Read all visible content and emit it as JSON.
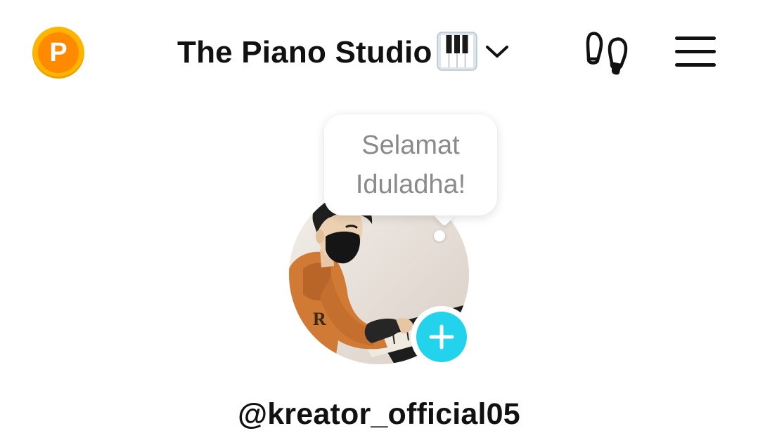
{
  "header": {
    "points_icon": "points-coin-icon",
    "points_letter": "P",
    "title": "The Piano Studio",
    "title_emoji_icon": "piano-keys-icon",
    "dropdown_icon": "chevron-down-icon",
    "visitors_icon": "footprints-icon",
    "menu_icon": "hamburger-menu-icon"
  },
  "profile": {
    "status_bubble": "Selamat Iduladha!",
    "avatar_icon": "avatar-piano-player",
    "add_story_icon": "plus-icon",
    "username": "@kreator_official05"
  },
  "colors": {
    "coin_outer": "#ffb400",
    "coin_inner": "#ff8a00",
    "add_button": "#23d3ec",
    "bubble_text": "#8a8a8a",
    "text_primary": "#111111"
  }
}
